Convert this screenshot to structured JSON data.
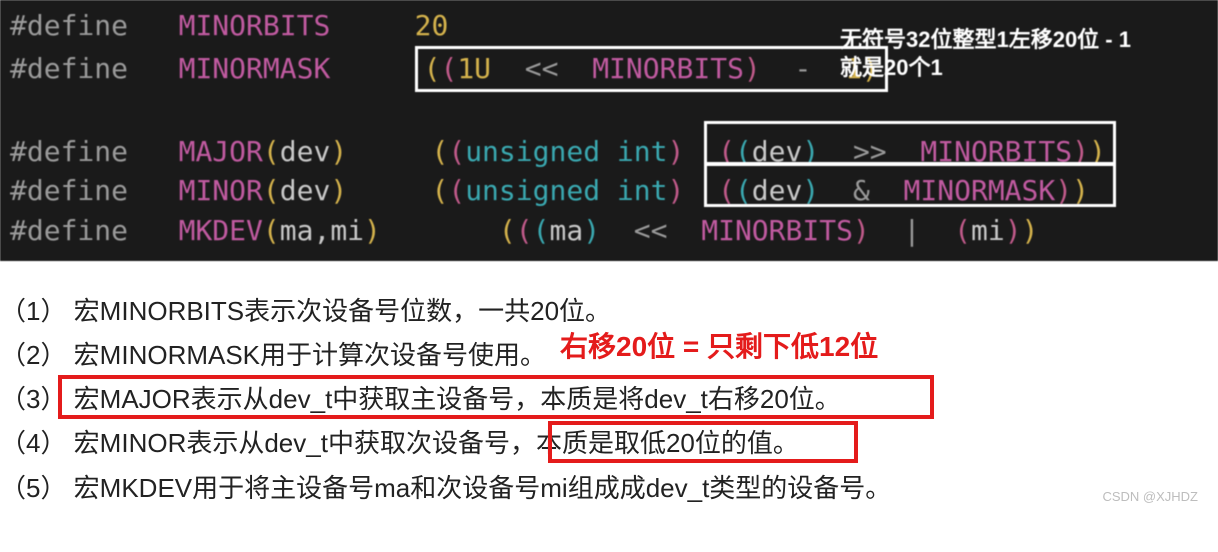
{
  "code": {
    "l1_pre": "#define",
    "l1_name": "MINORBITS",
    "l1_val": "20",
    "l2_pre": "#define",
    "l2_name": "MINORMASK",
    "l2_op_ls": "<<",
    "l2_ref": "MINORBITS",
    "l2_1u": "1U",
    "l2_minus": "-",
    "l2_one": "1",
    "l3_pre": "#define",
    "l3_name": "MAJOR",
    "l3_arg": "dev",
    "l3_type": "unsigned int",
    "l3_op": ">>",
    "l3_ref": "MINORBITS",
    "l4_pre": "#define",
    "l4_name": "MINOR",
    "l4_arg": "dev",
    "l4_type": "unsigned int",
    "l4_op": "&",
    "l4_ref": "MINORMASK",
    "l5_pre": "#define",
    "l5_name": "MKDEV",
    "l5_args": "ma,mi",
    "l5_ma": "ma",
    "l5_op": "<<",
    "l5_ref": "MINORBITS",
    "l5_pipe": "|",
    "l5_mi": "mi",
    "annot1_line1": "无符号32位整型1左移20位 - 1",
    "annot1_line2": "就是20个1"
  },
  "notes": {
    "n1": "（1） 宏MINORBITS表示次设备号位数，一共20位。",
    "n2": "（2） 宏MINORMASK用于计算次设备号使用。",
    "red": "右移20位 = 只剩下低12位",
    "n3": "（3） 宏MAJOR表示从dev_t中获取主设备号，本质是将dev_t右移20位。",
    "n4": "（4） 宏MINOR表示从dev_t中获取次设备号，本质是取低20位的值。",
    "n5": "（5） 宏MKDEV用于将主设备号ma和次设备号mi组成成dev_t类型的设备号。"
  },
  "watermark": "CSDN @XJHDZ"
}
